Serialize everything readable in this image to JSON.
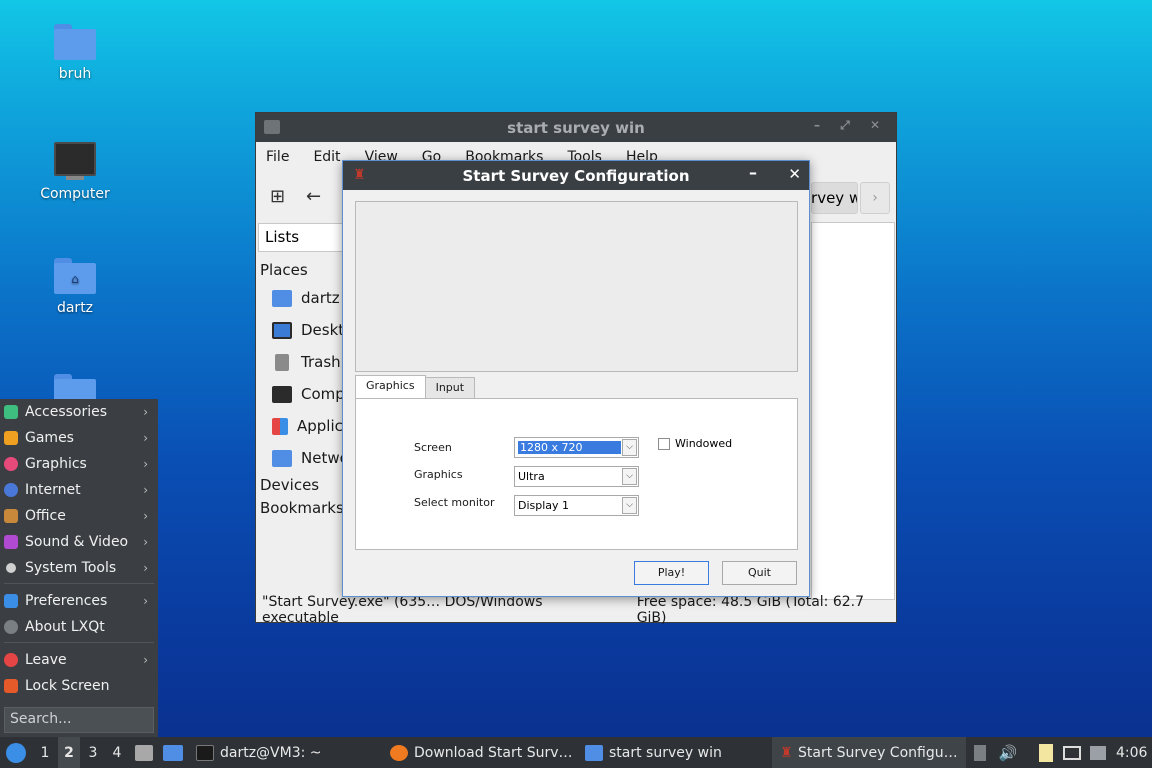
{
  "desktop": {
    "icons": [
      {
        "label": "bruh"
      },
      {
        "label": "Computer"
      },
      {
        "label": "dartz"
      },
      {
        "label": ""
      }
    ]
  },
  "file_manager": {
    "title": "start survey win",
    "menu": [
      "File",
      "Edit",
      "View",
      "Go",
      "Bookmarks",
      "Tools",
      "Help"
    ],
    "location": "start survey win",
    "side_pane_mode": "Lists",
    "places_header": "Places",
    "places": [
      "dartz",
      "Desktop",
      "Trash",
      "Computer",
      "Applications",
      "Network"
    ],
    "devices_header": "Devices",
    "bookmarks_header": "Bookmarks",
    "status_file": "\"Start Survey.exe\" (635… DOS/Windows executable",
    "status_free": "Free space: 48.5 GiB (Total: 62.7 GiB)"
  },
  "dialog": {
    "title": "Start Survey Configuration",
    "tabs": [
      "Graphics",
      "Input"
    ],
    "active_tab": "Graphics",
    "fields": {
      "screen_label": "Screen",
      "screen_value": "1280 x 720",
      "graphics_label": "Graphics",
      "graphics_value": "Ultra",
      "monitor_label": "Select monitor",
      "monitor_value": "Display 1",
      "windowed_label": "Windowed",
      "windowed_checked": false
    },
    "play_label": "Play!",
    "quit_label": "Quit"
  },
  "start_menu": {
    "items": [
      {
        "label": "Accessories",
        "submenu": true,
        "color": "#3fbf7f"
      },
      {
        "label": "Games",
        "submenu": true,
        "color": "#f0a020"
      },
      {
        "label": "Graphics",
        "submenu": true,
        "color": "#e64a7a"
      },
      {
        "label": "Internet",
        "submenu": true,
        "color": "#4a78d8"
      },
      {
        "label": "Office",
        "submenu": true,
        "color": "#c88a3a"
      },
      {
        "label": "Sound & Video",
        "submenu": true,
        "color": "#b04ad0"
      },
      {
        "label": "System Tools",
        "submenu": true,
        "color": "#d0d0d0"
      }
    ],
    "items2": [
      {
        "label": "Preferences",
        "submenu": true,
        "color": "#3a8ee6"
      },
      {
        "label": "About LXQt",
        "submenu": false,
        "color": "#7a7f84"
      }
    ],
    "items3": [
      {
        "label": "Leave",
        "submenu": true,
        "color": "#e64545"
      },
      {
        "label": "Lock Screen",
        "submenu": false,
        "color": "#e65a2a"
      }
    ],
    "search_placeholder": "Search..."
  },
  "taskbar": {
    "workspaces": [
      "1",
      "2",
      "3",
      "4"
    ],
    "active_workspace": "2",
    "tasks": [
      {
        "label": "dartz@VM3: ~",
        "icon": "terminal-icon"
      },
      {
        "label": "Download Start Surv…",
        "icon": "firefox-icon"
      },
      {
        "label": "start survey win",
        "icon": "folder-icon"
      },
      {
        "label": "Start Survey Configu…",
        "icon": "app-icon",
        "active": true
      }
    ],
    "clock": "4:06"
  }
}
